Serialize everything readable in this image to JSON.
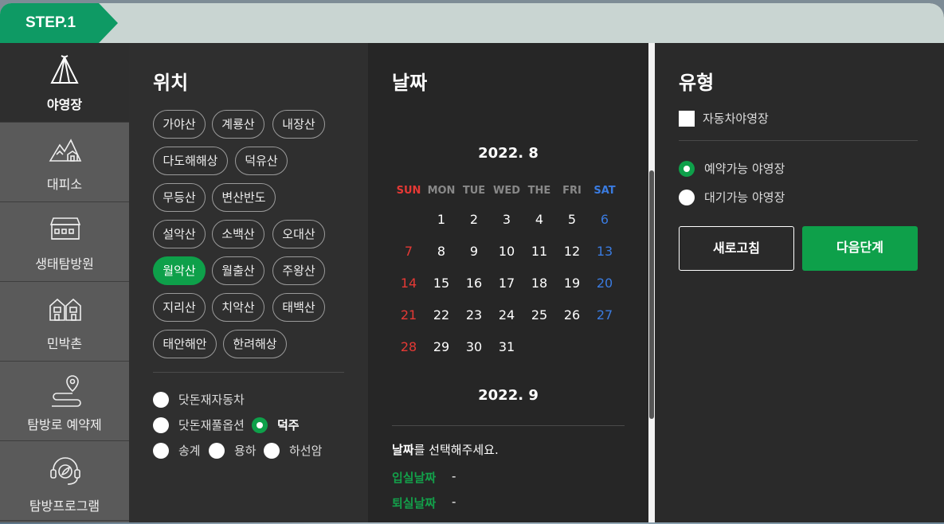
{
  "step": {
    "label": "STEP.1"
  },
  "menu": [
    {
      "label": "야영장",
      "icon": "tent-icon",
      "active": true
    },
    {
      "label": "대피소",
      "icon": "mountain-shelter-icon",
      "active": false
    },
    {
      "label": "생태탐방원",
      "icon": "building-icon",
      "active": false
    },
    {
      "label": "민박촌",
      "icon": "houses-icon",
      "active": false
    },
    {
      "label": "탐방로 예약제",
      "icon": "trail-pin-icon",
      "active": false
    },
    {
      "label": "탐방프로그램",
      "icon": "program-headset-icon",
      "active": false
    }
  ],
  "location": {
    "title": "위치",
    "chips": [
      "가야산",
      "계룡산",
      "내장산",
      "다도해해상",
      "덕유산",
      "무등산",
      "변산반도",
      "설악산",
      "소백산",
      "오대산",
      "월악산",
      "월출산",
      "주왕산",
      "지리산",
      "치악산",
      "태백산",
      "태안해안",
      "한려해상"
    ],
    "selected": "월악산",
    "options": [
      {
        "label": "닷돈재자동차",
        "checked": false
      },
      {
        "label": "닷돈재풀옵션",
        "checked": false
      },
      {
        "label": "덕주",
        "checked": true
      },
      {
        "label": "송계",
        "checked": false
      },
      {
        "label": "용하",
        "checked": false
      },
      {
        "label": "하선암",
        "checked": false
      }
    ]
  },
  "date": {
    "title": "날짜",
    "month1": "2022. 8",
    "month2": "2022. 9",
    "dow": [
      "SUN",
      "MON",
      "TUE",
      "WED",
      "THE",
      "FRI",
      "SAT"
    ],
    "weeks": [
      [
        "",
        "1",
        "2",
        "3",
        "4",
        "5",
        "6"
      ],
      [
        "7",
        "8",
        "9",
        "10",
        "11",
        "12",
        "13"
      ],
      [
        "14",
        "15",
        "16",
        "17",
        "18",
        "19",
        "20"
      ],
      [
        "21",
        "22",
        "23",
        "24",
        "25",
        "26",
        "27"
      ],
      [
        "28",
        "29",
        "30",
        "31",
        "",
        "",
        ""
      ]
    ],
    "prompt_bold": "날짜",
    "prompt_rest": "를 선택해주세요.",
    "checkin_label": "입실날짜",
    "checkin_value": "-",
    "checkout_label": "퇴실날짜",
    "checkout_value": "-"
  },
  "type": {
    "title": "유형",
    "checkbox_label": "자동차야영장",
    "radios": [
      {
        "label": "예약가능 야영장",
        "checked": true
      },
      {
        "label": "대기가능 야영장",
        "checked": false
      }
    ],
    "refresh_label": "새로고침",
    "next_label": "다음단계"
  },
  "colors": {
    "accent": "#0ea04a",
    "sunday": "#e53935",
    "saturday": "#3a7be0"
  }
}
